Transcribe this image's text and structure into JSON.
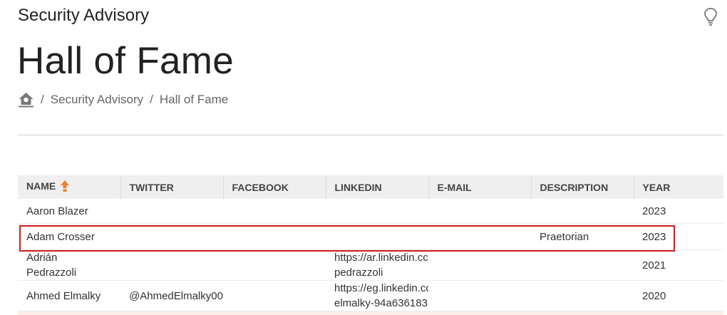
{
  "header": {
    "section_title": "Security Advisory",
    "page_title": "Hall of Fame",
    "icons": [
      "lightbulb-icon",
      "home-icon",
      "sort-arrow-up-icon"
    ],
    "accent_color": "#f08030",
    "highlight_color": "#cc1f1f"
  },
  "breadcrumb": {
    "separator": "/",
    "items": [
      "Security Advisory",
      "Hall of Fame"
    ]
  },
  "table": {
    "columns": [
      "NAME",
      "TWITTER",
      "FACEBOOK",
      "LINKEDIN",
      "E-MAIL",
      "DESCRIPTION",
      "YEAR"
    ],
    "rows": [
      {
        "name": [
          "Aaron Blazer"
        ],
        "twitter": "",
        "facebook": "",
        "linkedin": [],
        "email": "",
        "description": "",
        "year": "2023"
      },
      {
        "name": [
          "Adam Crosser"
        ],
        "twitter": "",
        "facebook": "",
        "linkedin": [],
        "email": "",
        "description": "Praetorian",
        "year": "2023"
      },
      {
        "name": [
          "Adrián",
          "Pedrazzoli"
        ],
        "twitter": "",
        "facebook": "",
        "linkedin": [
          "https://ar.linkedin.cc",
          "pedrazzoli"
        ],
        "email": "",
        "description": "",
        "year": "2021"
      },
      {
        "name": [
          "Ahmed Elmalky"
        ],
        "twitter": "@AhmedElmalky00",
        "facebook": "",
        "linkedin": [
          "https://eg.linkedin.cc",
          "elmalky-94a636183"
        ],
        "email": "",
        "description": "",
        "year": "2020"
      }
    ]
  }
}
